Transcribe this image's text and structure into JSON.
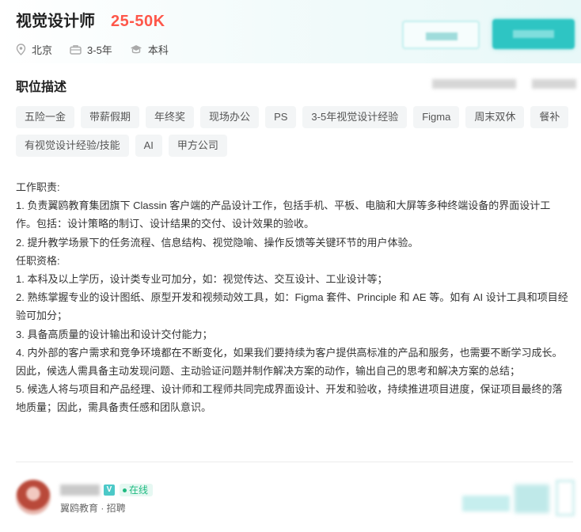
{
  "job": {
    "title": "视觉设计师",
    "salary": "25-50K",
    "location": "北京",
    "experience": "3-5年",
    "education": "本科"
  },
  "icons": {
    "location": "location-pin-icon",
    "experience": "briefcase-icon",
    "education": "graduation-cap-icon"
  },
  "section": {
    "title": "职位描述"
  },
  "tags": [
    "五险一金",
    "带薪假期",
    "年终奖",
    "现场办公",
    "PS",
    "3-5年视觉设计经验",
    "Figma",
    "周末双休",
    "餐补",
    "有视觉设计经验/技能",
    "AI",
    "甲方公司"
  ],
  "description": [
    "工作职责:",
    "1. 负责翼鸥教育集团旗下 Classin 客户端的产品设计工作，包括手机、平板、电脑和大屏等多种终端设备的界面设计工作。包括：设计策略的制订、设计结果的交付、设计效果的验收。",
    "2. 提升教学场景下的任务流程、信息结构、视觉隐喻、操作反馈等关键环节的用户体验。",
    "任职资格:",
    "1. 本科及以上学历，设计类专业可加分，如：视觉传达、交互设计、工业设计等；",
    "2. 熟练掌握专业的设计图纸、原型开发和视频动效工具，如：Figma 套件、Principle 和 AE 等。如有 AI 设计工具和项目经验可加分；",
    "3. 具备高质量的设计输出和设计交付能力；",
    "4. 内外部的客户需求和竞争环境都在不断变化，如果我们要持续为客户提供高标准的产品和服务，也需要不断学习成长。因此，候选人需具备主动发现问题、主动验证问题并制作解决方案的动作，输出自己的思考和解决方案的总结；",
    "5. 候选人将与项目和产品经理、设计师和工程师共同完成界面设计、开发和验收，持续推进项目进度，保证项目最终的落地质量；因此，需具备责任感和团队意识。"
  ],
  "recruiter": {
    "verified_badge": "V",
    "status": "在线",
    "company_role": "翼鸥教育 · 招聘"
  },
  "colors": {
    "accent": "#2ec5c3",
    "salary": "#fe574a",
    "online": "#1fba80",
    "tag_bg": "#f3f5f6"
  }
}
